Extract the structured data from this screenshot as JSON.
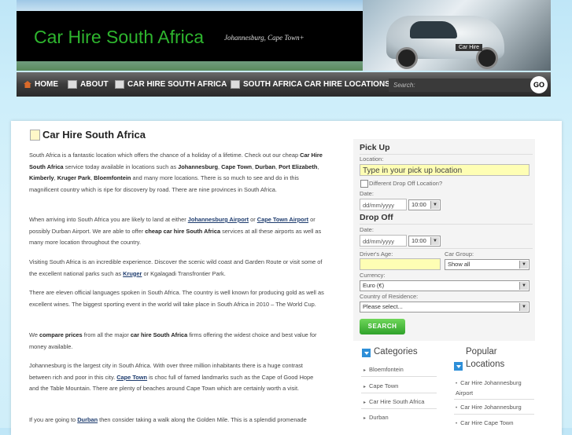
{
  "header": {
    "site_title": "Car Hire South Africa",
    "tagline": "Johannesburg, Cape Town+",
    "car_label": "Car Hire"
  },
  "nav": {
    "items": [
      {
        "label": "HOME",
        "icon": "home-icon"
      },
      {
        "label": "ABOUT",
        "icon": "page-icon"
      },
      {
        "label": "CAR HIRE SOUTH AFRICA",
        "icon": "page-icon"
      },
      {
        "label": "SOUTH AFRICA CAR HIRE LOCATIONS",
        "icon": "page-icon"
      }
    ],
    "search_placeholder": "Search:",
    "go_label": "GO"
  },
  "article": {
    "title": "Car Hire South Africa",
    "p1": {
      "t1": "South Africa is a fantastic location which offers the chance of a holiday of a lifetime.  Check out our cheap ",
      "b1": "Car Hire South Africa",
      "t2": " service today available in locations such as ",
      "b2": "Johannesburg",
      "t3": ", ",
      "b3": "Cape Town",
      "t4": ", ",
      "b4": "Durban",
      "t5": ", ",
      "b5": "Port Elizabeth",
      "t6": ", ",
      "b6": "Kimberly",
      "t7": ", ",
      "b7": "Kruger Park",
      "t8": ", ",
      "b8": "Bloemfontein",
      "t9": " and many more locations. There is so much to see and do in this magnificent country which is ripe for discovery by road. There are nine provinces in South Africa."
    },
    "p2": {
      "t1": "When arriving into South Africa you are likely to land at either ",
      "a1": "Johannesburg Airport",
      "t2": " or ",
      "a2": "Cape Town Airport",
      "t3": " or possibly Durban Airport. We are able to offer ",
      "b1": "cheap car hire South Africa",
      "t4": " services at all these airports as well as many more location throughout the country."
    },
    "p3": {
      "t1": "Visiting South Africa is an incredible experience. Discover the scenic wild coast and Garden Route or visit some of the excellent national parks such as ",
      "a1": "Kruger",
      "t2": " or Kgalagadi Transfrontier Park."
    },
    "p4": "There are eleven official languages spoken in South Africa. The country is well known for producing gold as well as excellent wines. The biggest sporting event in the world will take place in South Africa in 2010 – The World Cup.",
    "p5": {
      "t1": "We ",
      "b1": "compare prices",
      "t2": " from all the major ",
      "b2": "car hire South Africa",
      "t3": " firms offering the widest choice and best value for money available."
    },
    "p6": {
      "t1": "Johannesburg is the largest city in South Africa. With over three million inhabitants there is a huge contrast between rich and poor in this city. ",
      "a1": "Cape Town",
      "t2": " is choc full of famed landmarks such as the Cape of Good Hope and the Table Mountain. There are plenty of beaches around Cape Town which are certainly worth a visit."
    },
    "p7": {
      "t1": "If you are going to ",
      "a1": "Durban",
      "t2": " then consider taking a walk along the Golden Mile. This is a splendid promenade"
    }
  },
  "booking": {
    "pickup_heading": "Pick Up",
    "location_label": "Location:",
    "location_placeholder": "Type in your pick up location",
    "diff_dropoff_label": "Different Drop Off Location?",
    "date_label": "Date:",
    "date_placeholder": "dd/mm/yyyy",
    "time_value": "10:00",
    "dropoff_heading": "Drop Off",
    "dropoff_date_label": "Date:",
    "dropoff_date_placeholder": "dd/mm/yyyy",
    "dropoff_time_value": "10:00",
    "age_label": "Driver's Age:",
    "group_label": "Car Group:",
    "group_value": "Show all",
    "currency_label": "Currency:",
    "currency_value": "Euro (€)",
    "residence_label": "Country of Residence:",
    "residence_value": "Please select...",
    "search_button": "SEARCH"
  },
  "categories": {
    "heading": "Categories",
    "items": [
      "Bloemfontein",
      "Cape Town",
      "Car Hire South Africa",
      "Durban"
    ]
  },
  "popular": {
    "heading_line1": "Popular",
    "heading_line2": "Locations",
    "items": [
      "Car Hire Johannesburg Airport",
      "Car Hire Johannesburg",
      "Car Hire Cape Town"
    ]
  },
  "colors": {
    "title_green": "#2eb52e",
    "nav_bg": "#3c3c3c",
    "input_yellow": "#fefeb4",
    "button_green": "#2fa22a",
    "accent_blue": "#2e8fd8"
  }
}
